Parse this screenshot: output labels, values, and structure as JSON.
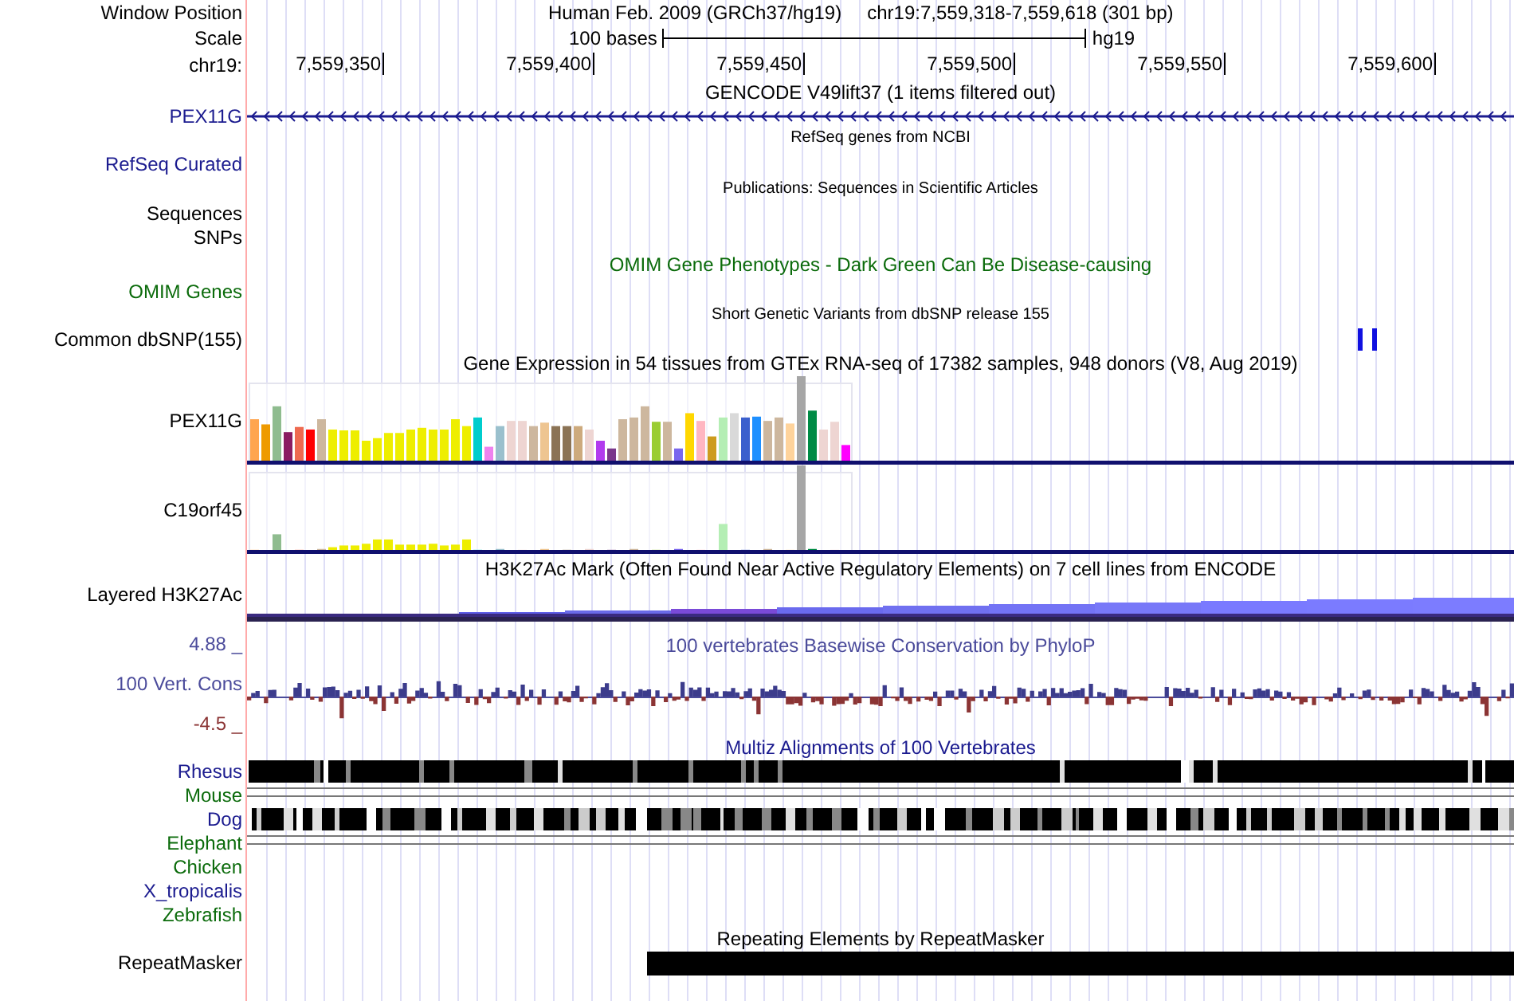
{
  "header": {
    "label": "Window Position",
    "assembly": "Human Feb. 2009 (GRCh37/hg19)",
    "position": "chr19:7,559,318-7,559,618 (301 bp)"
  },
  "scale": {
    "label": "Scale",
    "length": "100 bases",
    "assembly": "hg19"
  },
  "ruler": {
    "label": "chr19:",
    "ticks": [
      "7,559,350",
      "7,559,400",
      "7,559,450",
      "7,559,500",
      "7,559,550",
      "7,559,600"
    ]
  },
  "tracks": [
    {
      "kind": "gene",
      "title": "GENCODE V49lift37 (1 items filtered out)",
      "label": "PEX11G",
      "color": "#1b1b8f"
    },
    {
      "kind": "empty",
      "title": "RefSeq genes from NCBI",
      "label": "RefSeq Curated",
      "color": "#1b1b8f"
    },
    {
      "kind": "empty",
      "title": "Publications: Sequences in Scientific Articles",
      "label": "Sequences",
      "color": "#000000"
    },
    {
      "kind": "label",
      "label": "SNPs",
      "color": "#000000"
    },
    {
      "kind": "phenotype",
      "title": "OMIM Gene Phenotypes - Dark Green Can Be Disease-causing",
      "label": "OMIM Genes",
      "color": "#0b6b0b"
    },
    {
      "kind": "snp",
      "title": "Short Genetic Variants from dbSNP release 155",
      "label": "Common dbSNP(155)",
      "color": "#000000"
    },
    {
      "kind": "expression",
      "title": "Gene Expression in 54 tissues from GTEx RNA-seq of 17382 samples, 948 donors (V8, Aug 2019)",
      "genes": [
        {
          "label": "PEX11G"
        },
        {
          "label": "C19orf45"
        }
      ]
    },
    {
      "kind": "layered",
      "title": "H3K27Ac Mark (Often Found Near Active Regulatory Elements) on 7 cell lines from ENCODE",
      "label": "Layered H3K27Ac",
      "color": "#000000"
    },
    {
      "kind": "conservation",
      "title": "100 vertebrates Basewise Conservation by PhyloP",
      "label": "100 Vert. Cons",
      "max": "4.88 _",
      "min": "-4.5 _",
      "color": "#4b4b9b"
    },
    {
      "kind": "multiz",
      "title": "Multiz Alignments of 100 Vertebrates",
      "species": [
        {
          "name": "Rhesus",
          "color": "#1b1b8f",
          "kind": "blocks"
        },
        {
          "name": "Mouse",
          "color": "#0b6b0b",
          "kind": "lines"
        },
        {
          "name": "Dog",
          "color": "#1b1b8f",
          "kind": "dense"
        },
        {
          "name": "Elephant",
          "color": "#0b6b0b",
          "kind": "lines"
        },
        {
          "name": "Chicken",
          "color": "#0b6b0b",
          "kind": "none"
        },
        {
          "name": "X_tropicalis",
          "color": "#1b1b8f",
          "kind": "none"
        },
        {
          "name": "Zebrafish",
          "color": "#0b6b0b",
          "kind": "none"
        }
      ]
    },
    {
      "kind": "repeat",
      "title": "Repeating Elements by RepeatMasker",
      "label": "RepeatMasker",
      "color": "#000000"
    }
  ]
}
